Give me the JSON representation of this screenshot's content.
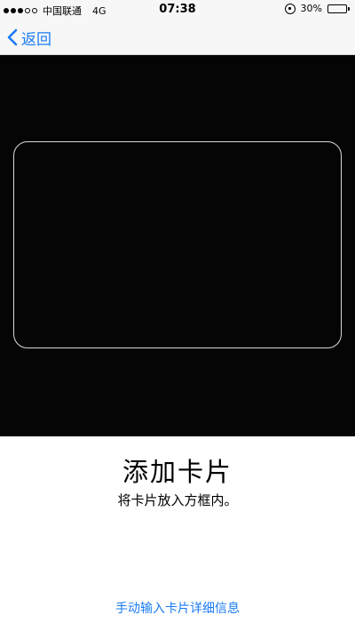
{
  "status_bar": {
    "carrier": "中国联通",
    "network": "4G",
    "time": "07:38",
    "battery": "30%",
    "battery_level": 0.3,
    "signal": [
      true,
      true,
      true,
      false,
      false
    ]
  },
  "nav": {
    "back_label": "返回",
    "accent_color": "#1a7cf5"
  },
  "scanner": {
    "title": "添加卡片",
    "instruction": "将卡片放入方框内。",
    "manual_entry_link": "手动输入卡片详细信息"
  }
}
